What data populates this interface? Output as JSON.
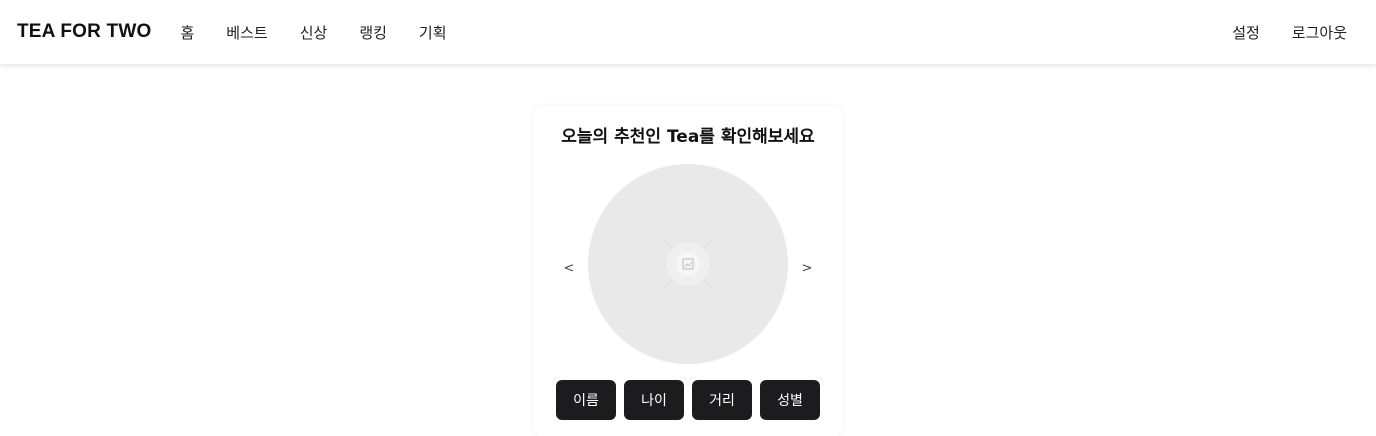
{
  "header": {
    "logo": "TEA FOR TWO",
    "nav": [
      {
        "label": "홈"
      },
      {
        "label": "베스트"
      },
      {
        "label": "신상"
      },
      {
        "label": "랭킹"
      },
      {
        "label": "기획"
      }
    ],
    "right": [
      {
        "label": "설정"
      },
      {
        "label": "로그아웃"
      }
    ]
  },
  "recommend": {
    "title": "오늘의 추천인 Tea를 확인해보세요",
    "prev": "<",
    "next": ">",
    "image_icon": "broken-image-icon",
    "buttons": [
      {
        "label": "이름"
      },
      {
        "label": "나이"
      },
      {
        "label": "거리"
      },
      {
        "label": "성별"
      }
    ]
  },
  "colors": {
    "button_bg": "#1c1c1e",
    "placeholder_bg": "#e9e9e9"
  }
}
